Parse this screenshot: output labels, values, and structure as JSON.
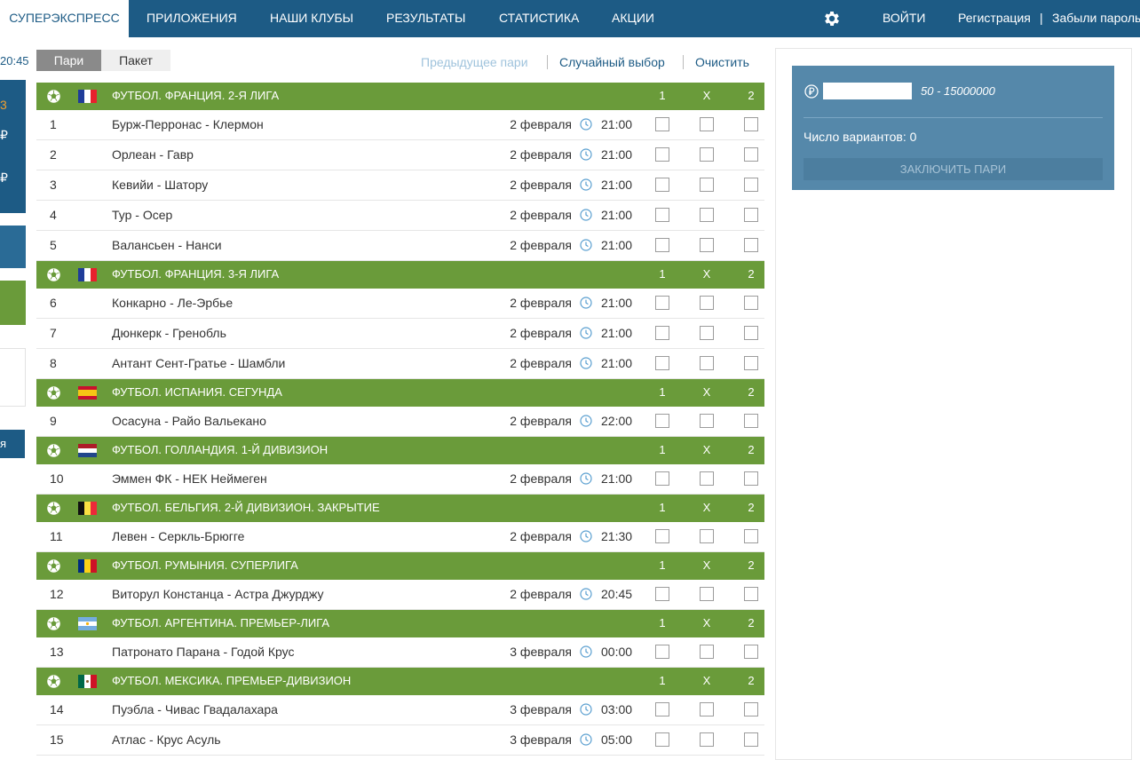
{
  "nav": {
    "active_tab": "СУПЕРЭКСПРЕСС",
    "tabs": [
      "ПРИЛОЖЕНИЯ",
      "НАШИ КЛУБЫ",
      "РЕЗУЛЬТАТЫ",
      "СТАТИСТИКА",
      "АКЦИИ"
    ],
    "login": "ВОЙТИ",
    "register": "Регистрация",
    "forgot": "Забыли пароль"
  },
  "left": {
    "time": "20:45",
    "c1": "3",
    "c2": "₽",
    "c3": "₽",
    "c4": "я"
  },
  "subtabs": {
    "pari": "Пари",
    "paket": "Пакет"
  },
  "actions": {
    "prev": "Предыдущее пари",
    "random": "Случайный выбор",
    "clear": "Очистить"
  },
  "columns": {
    "c1": "1",
    "cx": "X",
    "c2": "2"
  },
  "groups": [
    {
      "league": "ФУТБОЛ. ФРАНЦИЯ. 2-Я ЛИГА",
      "flag": "france",
      "matches": [
        {
          "num": "1",
          "teams": "Бурж-Перронас - Клермон",
          "date": "2 февраля",
          "time": "21:00"
        },
        {
          "num": "2",
          "teams": "Орлеан - Гавр",
          "date": "2 февраля",
          "time": "21:00"
        },
        {
          "num": "3",
          "teams": "Кевийи - Шатору",
          "date": "2 февраля",
          "time": "21:00"
        },
        {
          "num": "4",
          "teams": "Тур - Осер",
          "date": "2 февраля",
          "time": "21:00"
        },
        {
          "num": "5",
          "teams": "Валансьен - Нанси",
          "date": "2 февраля",
          "time": "21:00"
        }
      ]
    },
    {
      "league": "ФУТБОЛ. ФРАНЦИЯ. 3-Я ЛИГА",
      "flag": "france",
      "matches": [
        {
          "num": "6",
          "teams": "Конкарно - Ле-Эрбье",
          "date": "2 февраля",
          "time": "21:00"
        },
        {
          "num": "7",
          "teams": "Дюнкерк - Гренобль",
          "date": "2 февраля",
          "time": "21:00"
        },
        {
          "num": "8",
          "teams": "Антант Сент-Гратье - Шамбли",
          "date": "2 февраля",
          "time": "21:00"
        }
      ]
    },
    {
      "league": "ФУТБОЛ. ИСПАНИЯ. СЕГУНДА",
      "flag": "spain",
      "matches": [
        {
          "num": "9",
          "teams": "Осасуна - Райо Вальекано",
          "date": "2 февраля",
          "time": "22:00"
        }
      ]
    },
    {
      "league": "ФУТБОЛ. ГОЛЛАНДИЯ. 1-Й ДИВИЗИОН",
      "flag": "netherlands",
      "matches": [
        {
          "num": "10",
          "teams": "Эммен ФК - НЕК Неймеген",
          "date": "2 февраля",
          "time": "21:00"
        }
      ]
    },
    {
      "league": "ФУТБОЛ. БЕЛЬГИЯ. 2-Й ДИВИЗИОН. ЗАКРЫТИЕ",
      "flag": "belgium",
      "matches": [
        {
          "num": "11",
          "teams": "Левен - Серкль-Брюгге",
          "date": "2 февраля",
          "time": "21:30"
        }
      ]
    },
    {
      "league": "ФУТБОЛ. РУМЫНИЯ. СУПЕРЛИГА",
      "flag": "romania",
      "matches": [
        {
          "num": "12",
          "teams": "Виторул Констанца - Астра Джурджу",
          "date": "2 февраля",
          "time": "20:45"
        }
      ]
    },
    {
      "league": "ФУТБОЛ. АРГЕНТИНА. ПРЕМЬЕР-ЛИГА",
      "flag": "argentina",
      "matches": [
        {
          "num": "13",
          "teams": "Патронато Парана - Годой Крус",
          "date": "3 февраля",
          "time": "00:00"
        }
      ]
    },
    {
      "league": "ФУТБОЛ. МЕКСИКА. ПРЕМЬЕР-ДИВИЗИОН",
      "flag": "mexico",
      "matches": [
        {
          "num": "14",
          "teams": "Пуэбла - Чивас Гвадалахара",
          "date": "3 февраля",
          "time": "03:00"
        },
        {
          "num": "15",
          "teams": "Атлас - Крус Асуль",
          "date": "3 февраля",
          "time": "05:00"
        }
      ]
    }
  ],
  "slip": {
    "stake_value": "",
    "range": "50 - 15000000",
    "variants": "Число вариантов: 0",
    "place_button": "ЗАКЛЮЧИТЬ ПАРИ"
  },
  "colors": {
    "nav": "#1d5b85",
    "league": "#6a9b3a",
    "slip": "#5588aa",
    "link": "#1d5b85"
  }
}
